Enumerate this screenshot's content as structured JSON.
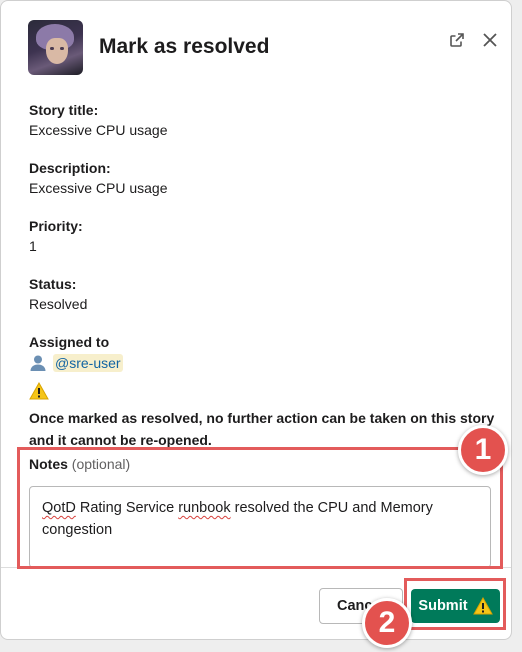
{
  "modal": {
    "title": "Mark as resolved"
  },
  "fields": [
    {
      "label": "Story title:",
      "value": "Excessive CPU usage"
    },
    {
      "label": "Description:",
      "value": "Excessive CPU usage"
    },
    {
      "label": "Priority:",
      "value": "1"
    },
    {
      "label": "Status:",
      "value": "Resolved"
    }
  ],
  "assigned": {
    "label": "Assigned to",
    "user": "@sre-user",
    "icon": "user-icon"
  },
  "warning": {
    "icon": "warning-icon",
    "text": "Once marked as resolved, no further action can be taken on this story and it cannot be re-opened."
  },
  "notes": {
    "label": "Notes",
    "optional": "(optional)",
    "value_parts": [
      "QotD",
      " Rating Service ",
      "runbook",
      " resolved the CPU and Memory congestion"
    ]
  },
  "buttons": {
    "cancel": "Cancel",
    "submit": "Submit"
  },
  "annotations": {
    "badge1": "1",
    "badge2": "2",
    "color": "#e35b5b"
  },
  "colors": {
    "submit_bg": "#007a5a",
    "mention_bg": "#f7efcc",
    "mention_fg": "#1264a3"
  }
}
